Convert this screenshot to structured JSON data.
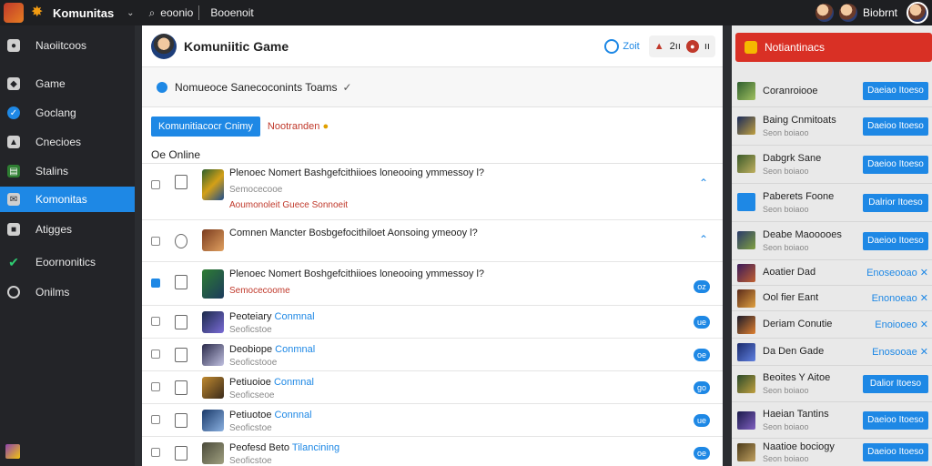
{
  "topbar": {
    "app_title": "Komunitas",
    "search_label": "eoonio",
    "search_value": "Booenoit",
    "username": "Biobrnt"
  },
  "sidebar": {
    "items": [
      {
        "label": "Naoiitcoos",
        "icon": "avatar-icon"
      },
      {
        "label": "Game",
        "icon": "game-icon"
      },
      {
        "label": "Goclang",
        "icon": "globe-icon"
      },
      {
        "label": "Cnecioes",
        "icon": "home-icon"
      },
      {
        "label": "Stalins",
        "icon": "chart-icon"
      },
      {
        "label": "Komonitas",
        "icon": "community-icon"
      },
      {
        "label": "Atigges",
        "icon": "badge-icon"
      },
      {
        "label": "Eoornonitics",
        "icon": "check-icon"
      },
      {
        "label": "Onilms",
        "icon": "online-icon"
      }
    ]
  },
  "main": {
    "title": "Komuniitic Game",
    "online_count": "Zoit",
    "notif_count": "2ıı",
    "notif_close": "ıı",
    "subheader": "Nomueoce Sanecoconints Toams",
    "primary_button": "Komunitiacocr Cnimy",
    "notif_link": "Nootranden",
    "section_label": "Oe Online",
    "rows": [
      {
        "line1": "Plenoec Nomert Bashgefcithiioes loneooing ymmessoy l?",
        "line2": "Semocecooe",
        "line3": "Aoumonoleit Guece Sonnoeit",
        "badge": ""
      },
      {
        "line1": "Comnen Mancter Bosbgefocithiloet Aonsoing ymeooy l?",
        "line2": "",
        "line3": "",
        "badge": ""
      },
      {
        "line1": "Plenoec Nomert Boshgefcithiioes loneooing ymmessoy l?",
        "line2": "Semocecoome",
        "line3": "",
        "badge": "oz"
      },
      {
        "line1": "Peoteiary",
        "line1_link": "Conmnal",
        "line2": "Seoficstoe",
        "badge": "ue"
      },
      {
        "line1": "Deobiope",
        "line1_link": "Conmnal",
        "line2": "Seoficstooe",
        "badge": "oe"
      },
      {
        "line1": "Petiuoioe",
        "line1_link": "Conmnal",
        "line2": "Seoficseoe",
        "badge": "go"
      },
      {
        "line1": "Petiuotoe",
        "line1_link": "Connnal",
        "line2": "Seoficstoe",
        "badge": "ue"
      },
      {
        "line1": "Peofesd Beto",
        "line1_link": "Tilancining",
        "line2": "Seoficstoe",
        "badge": "oe"
      }
    ]
  },
  "right_panel": {
    "header": "Notiantinacs",
    "rows": [
      {
        "name": "Coranroiooe",
        "sub": "",
        "action": "Daeiao Itoeso",
        "style": "button"
      },
      {
        "name": "Baing Cnmitoats",
        "sub": "Seon boiaoo",
        "action": "Daeioo Itoeso",
        "style": "button"
      },
      {
        "name": "Dabgrk Sane",
        "sub": "Seon boiaoo",
        "action": "Daeioo Itoeso",
        "style": "button"
      },
      {
        "name": "Paberets Foone",
        "sub": "Seon boiaoo",
        "action": "Dalrior Itoeso",
        "style": "button"
      },
      {
        "name": "Deabe Maooooes",
        "sub": "Seon boiaoo",
        "action": "Daeioo Itoeso",
        "style": "button"
      },
      {
        "name": "Aoatier Dad",
        "sub": "",
        "action": "Enoseooao ✕",
        "style": "link"
      },
      {
        "name": "Ool fier Eant",
        "sub": "",
        "action": "Enonoeao ✕",
        "style": "link"
      },
      {
        "name": "Deriam Conutie",
        "sub": "",
        "action": "Enoiooeo ✕",
        "style": "link"
      },
      {
        "name": "Da Den Gade",
        "sub": "",
        "action": "Enosooae ✕",
        "style": "link"
      },
      {
        "name": "Beoites Y Aitoe",
        "sub": "Seon boiaoo",
        "action": "Dalior Itoeso",
        "style": "button"
      },
      {
        "name": "Haeian Tantins",
        "sub": "Seon boiaoo",
        "action": "Daeioo Itoeso",
        "style": "button"
      },
      {
        "name": "Naatioe bociogy",
        "sub": "Seon boiaoo",
        "action": "Daeioo Itoeso",
        "style": "button"
      }
    ]
  },
  "colors": {
    "accent": "#1e88e5",
    "danger": "#d93025",
    "sidebar": "#232428",
    "topbar": "#1e1f22"
  }
}
